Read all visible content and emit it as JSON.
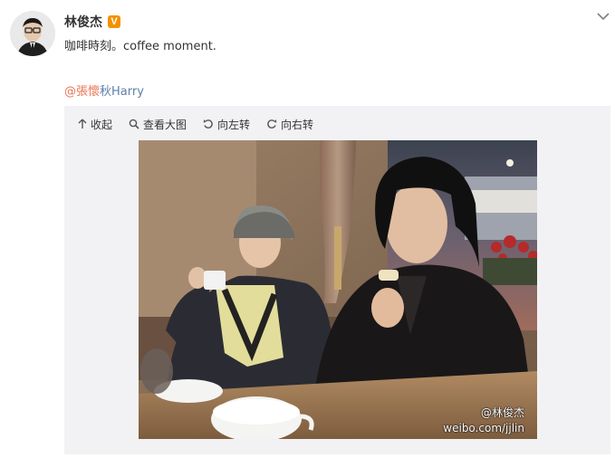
{
  "post": {
    "author": "林俊杰",
    "verified_badge": "V",
    "text": "咖啡時刻。coffee moment.",
    "mention_head": "@張懷",
    "mention_tail": "秋Harry"
  },
  "media_toolbar": {
    "collapse": "收起",
    "view_large": "查看大图",
    "rotate_left": "向左转",
    "rotate_right": "向右转"
  },
  "photo": {
    "watermark_line1": "@林俊杰",
    "watermark_line2": "weibo.com/jjlin"
  },
  "colors": {
    "mention_highlight": "#eb7350",
    "link_blue": "#5e7fa8",
    "verified_orange": "#f29100",
    "media_background": "#f2f2f5"
  },
  "icons": [
    "avatar",
    "verified-badge-icon",
    "chevron-down-icon",
    "collapse-arrow-icon",
    "zoom-icon",
    "rotate-left-icon",
    "rotate-right-icon"
  ]
}
